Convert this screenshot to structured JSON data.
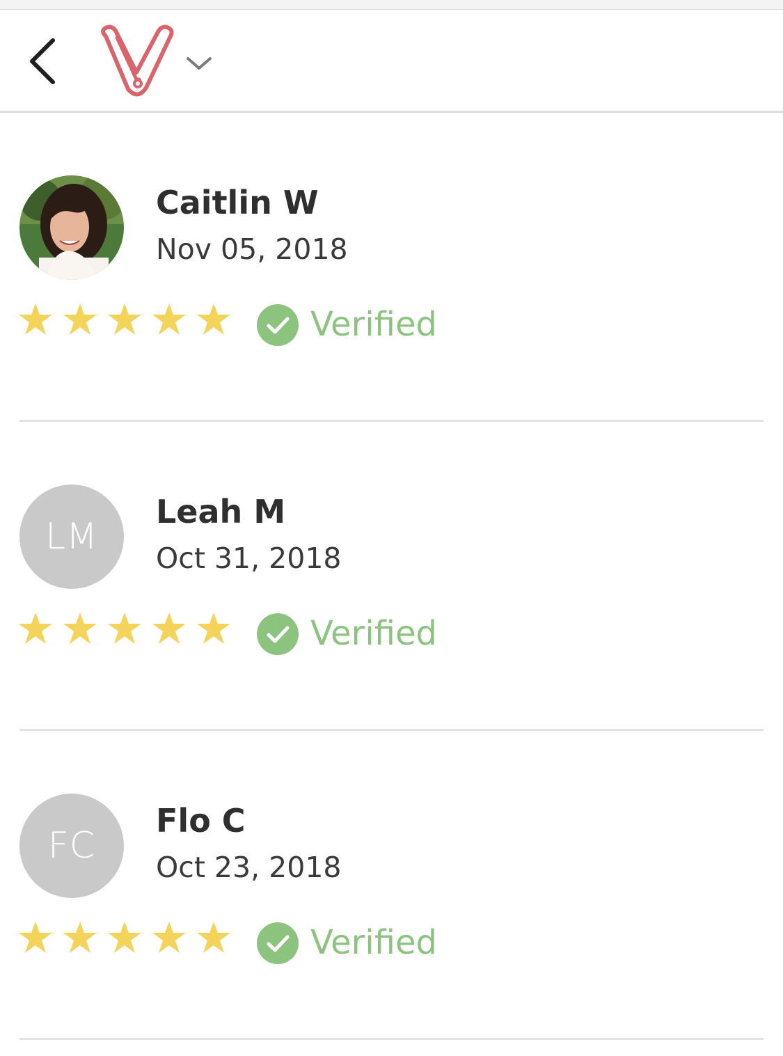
{
  "header": {
    "back_icon": "chevron-left-icon",
    "logo_icon": "brand-logo-icon",
    "menu_icon": "chevron-down-icon"
  },
  "colors": {
    "brand": "#d9646c",
    "star": "#f3d35a",
    "verified": "#8cc47f",
    "avatar_placeholder": "#c9c9c9"
  },
  "reviews": [
    {
      "name": "Caitlin W",
      "date": "Nov 05, 2018",
      "avatar_initials": "",
      "avatar_type": "photo",
      "rating": 5,
      "verified_label": "Verified"
    },
    {
      "name": "Leah M",
      "date": "Oct 31, 2018",
      "avatar_initials": "LM",
      "avatar_type": "initials",
      "rating": 5,
      "verified_label": "Verified"
    },
    {
      "name": "Flo C",
      "date": "Oct 23, 2018",
      "avatar_initials": "FC",
      "avatar_type": "initials",
      "rating": 5,
      "verified_label": "Verified"
    }
  ]
}
